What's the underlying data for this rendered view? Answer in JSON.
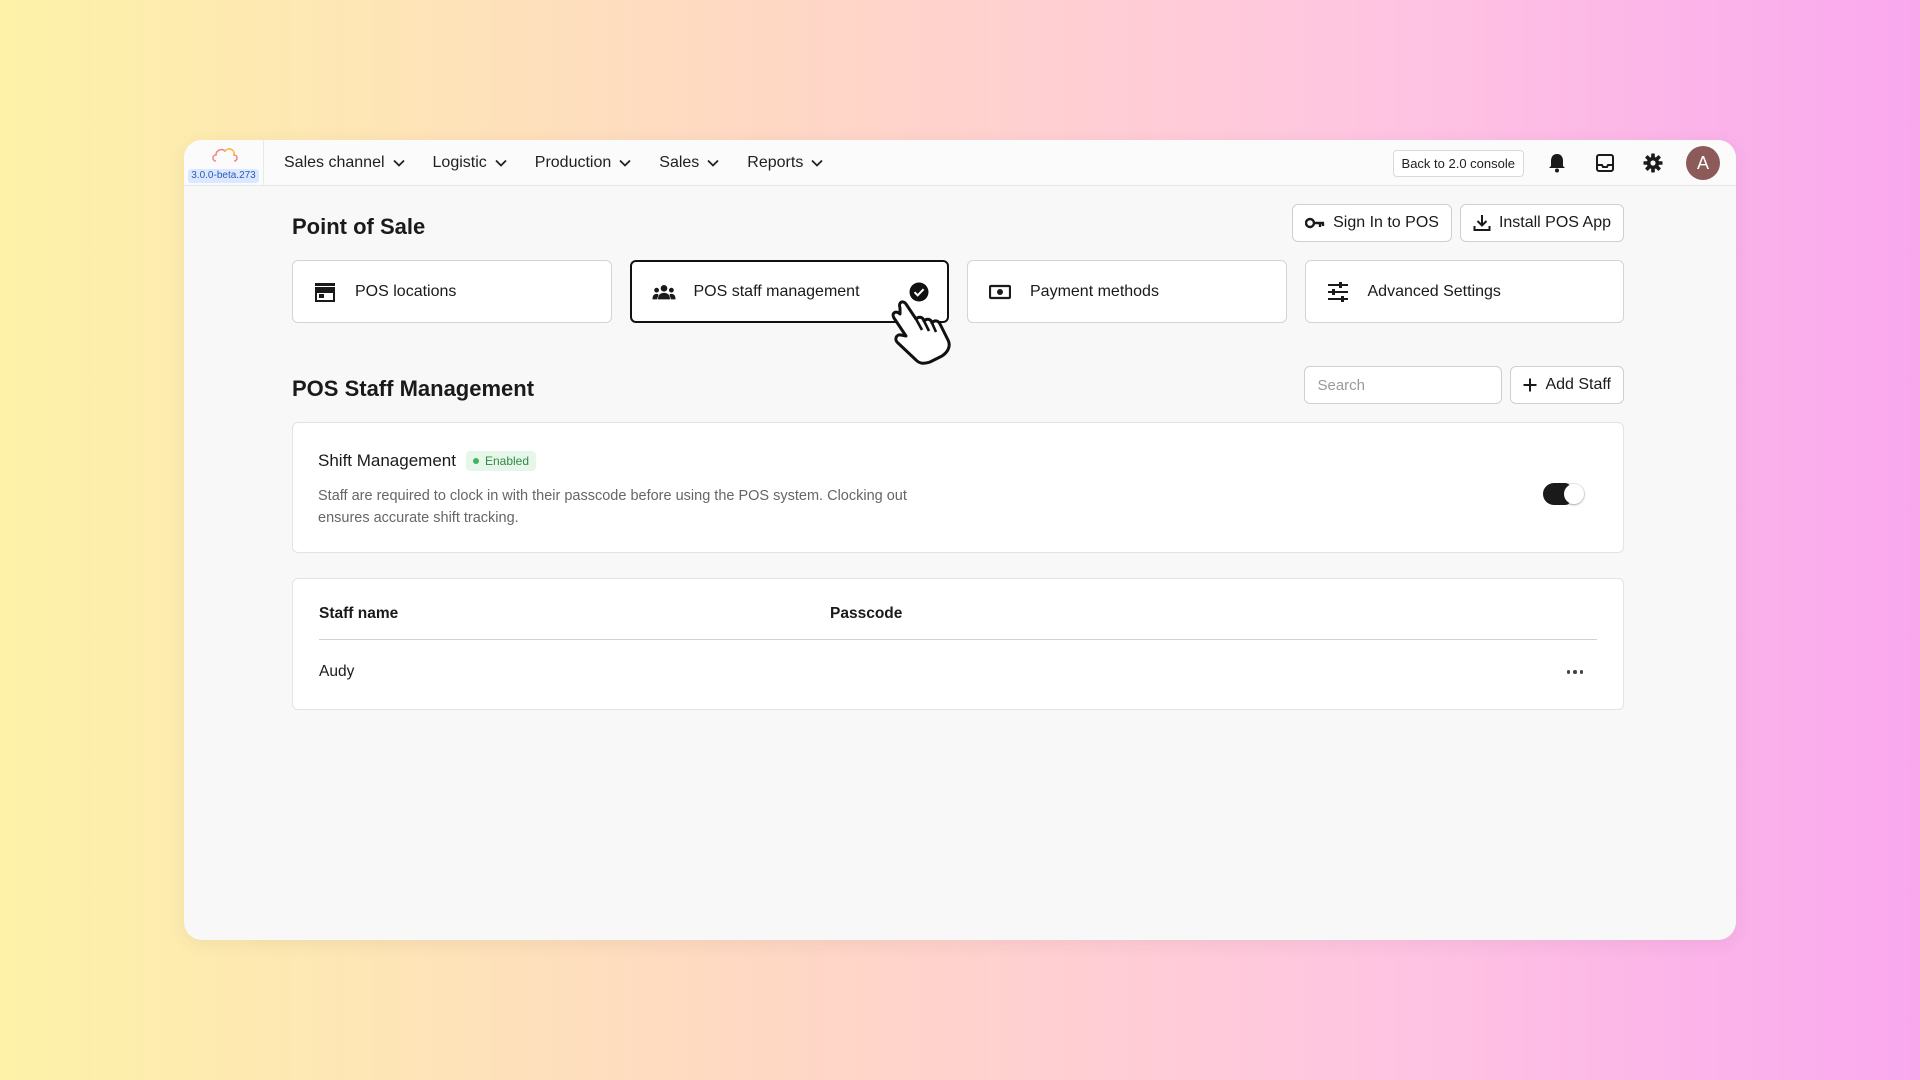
{
  "app": {
    "version": "3.0.0-beta.273"
  },
  "nav": {
    "items": [
      {
        "label": "Sales channel"
      },
      {
        "label": "Logistic"
      },
      {
        "label": "Production"
      },
      {
        "label": "Sales"
      },
      {
        "label": "Reports"
      }
    ]
  },
  "topbar": {
    "back_label": "Back to 2.0 console",
    "avatar_initial": "A"
  },
  "page": {
    "title": "Point of Sale",
    "sign_in_label": "Sign In to POS",
    "install_label": "Install POS App"
  },
  "cards": [
    {
      "label": "POS locations",
      "icon": "store-icon"
    },
    {
      "label": "POS staff management",
      "icon": "people-icon",
      "active": true
    },
    {
      "label": "Payment methods",
      "icon": "cash-icon"
    },
    {
      "label": "Advanced Settings",
      "icon": "sliders-icon"
    }
  ],
  "staff": {
    "title": "POS Staff Management",
    "search_placeholder": "Search",
    "add_label": "Add Staff"
  },
  "shift": {
    "title": "Shift Management",
    "status": "Enabled",
    "description": "Staff are required to clock in with their passcode before using the POS system. Clocking out ensures accurate shift tracking.",
    "enabled": true
  },
  "table": {
    "columns": [
      "Staff name",
      "Passcode"
    ],
    "rows": [
      {
        "name": "Audy",
        "passcode": ""
      }
    ]
  },
  "colors": {
    "accent": "#111111",
    "badge_bg": "#e6f7ea",
    "badge_text": "#2f8a45",
    "avatar": "#8d5a5a"
  }
}
